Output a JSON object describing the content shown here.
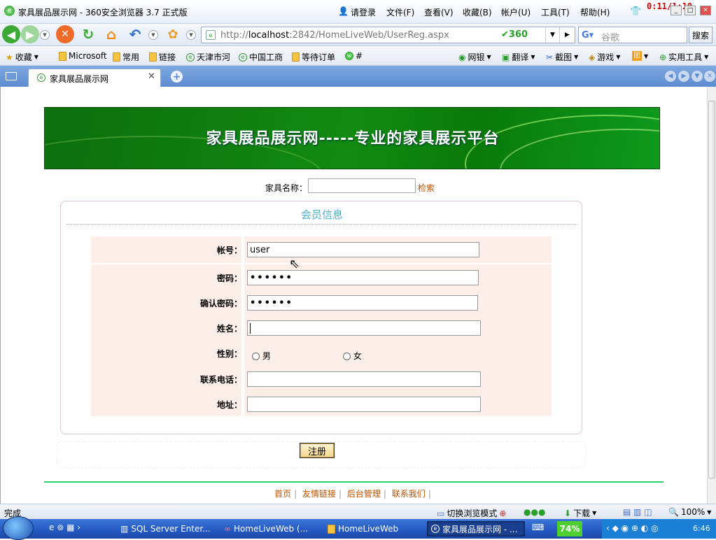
{
  "window": {
    "title": "家具展品展示网 - 360安全浏览器 3.7 正式版",
    "recorder": "0:11/1:10",
    "menu": [
      "请登录",
      "文件(F)",
      "查看(V)",
      "收藏(B)",
      "帐户(U)",
      "工具(T)",
      "帮助(H)"
    ]
  },
  "nav": {
    "url_prefix": "http://",
    "url_host": "localhost",
    "url_path": ":2842/HomeLiveWeb/UserReg.aspx",
    "safe_badge": "360",
    "search_placeholder": "谷歌",
    "search_button": "搜索"
  },
  "bookmarks": [
    "收藏",
    "Microsoft",
    "常用",
    "链接",
    "天津市河",
    "中国工商",
    "等待订单",
    "#"
  ],
  "bookmarks_right": [
    "网银",
    "翻译",
    "截图",
    "游戏",
    "团",
    "实用工具"
  ],
  "tab": {
    "label": "家具展品展示网"
  },
  "page": {
    "banner_title": "家具展品展示网-----专业的家具展示平台",
    "search_label": "家具名称：",
    "search_link": "检索",
    "panel_title": "会员信息",
    "fields": {
      "account_label": "帐号：",
      "account_value": "user",
      "password_label": "密码：",
      "password_value": "••••••",
      "confirm_label": "确认密码：",
      "confirm_value": "••••••",
      "name_label": "姓名：",
      "name_value": "",
      "gender_label": "性别：",
      "gender_male": "男",
      "gender_female": "女",
      "phone_label": "联系电话：",
      "phone_value": "",
      "address_label": "地址：",
      "address_value": ""
    },
    "register_button": "注册",
    "footer_links": [
      "首页",
      "友情链接",
      "后台管理",
      "联系我们"
    ]
  },
  "status": {
    "text": "完成",
    "mode": "切换浏览模式",
    "download": "下载",
    "zoom": "100%"
  },
  "taskbar": {
    "items": [
      "SQL Server Enter...",
      "HomeLiveWeb (...",
      "HomeLiveWeb",
      "家具展品展示网 - ..."
    ],
    "cpu": "74%",
    "clock": "6:46"
  }
}
